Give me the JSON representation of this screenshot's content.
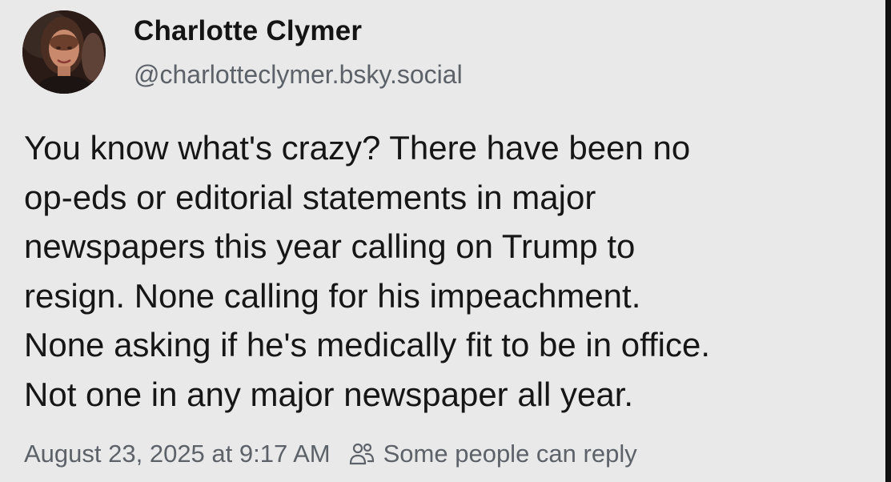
{
  "author": {
    "display_name": "Charlotte Clymer",
    "handle": "@charlotteclymer.bsky.social"
  },
  "post": {
    "lines": [
      "You know what's crazy? There have been no",
      "op-eds or editorial statements in major",
      "newspapers this year calling on Trump to",
      "resign. None calling for his impeachment.",
      "None asking if he's medically fit to be in office.",
      "Not one in any major newspaper all year."
    ]
  },
  "footer": {
    "timestamp": "August 23, 2025 at 9:17 AM",
    "reply_icon": "people-icon",
    "reply_setting": "Some people can reply"
  },
  "colors": {
    "background": "#e9e9ea",
    "text_primary": "#161616",
    "text_secondary": "#5d6168"
  }
}
